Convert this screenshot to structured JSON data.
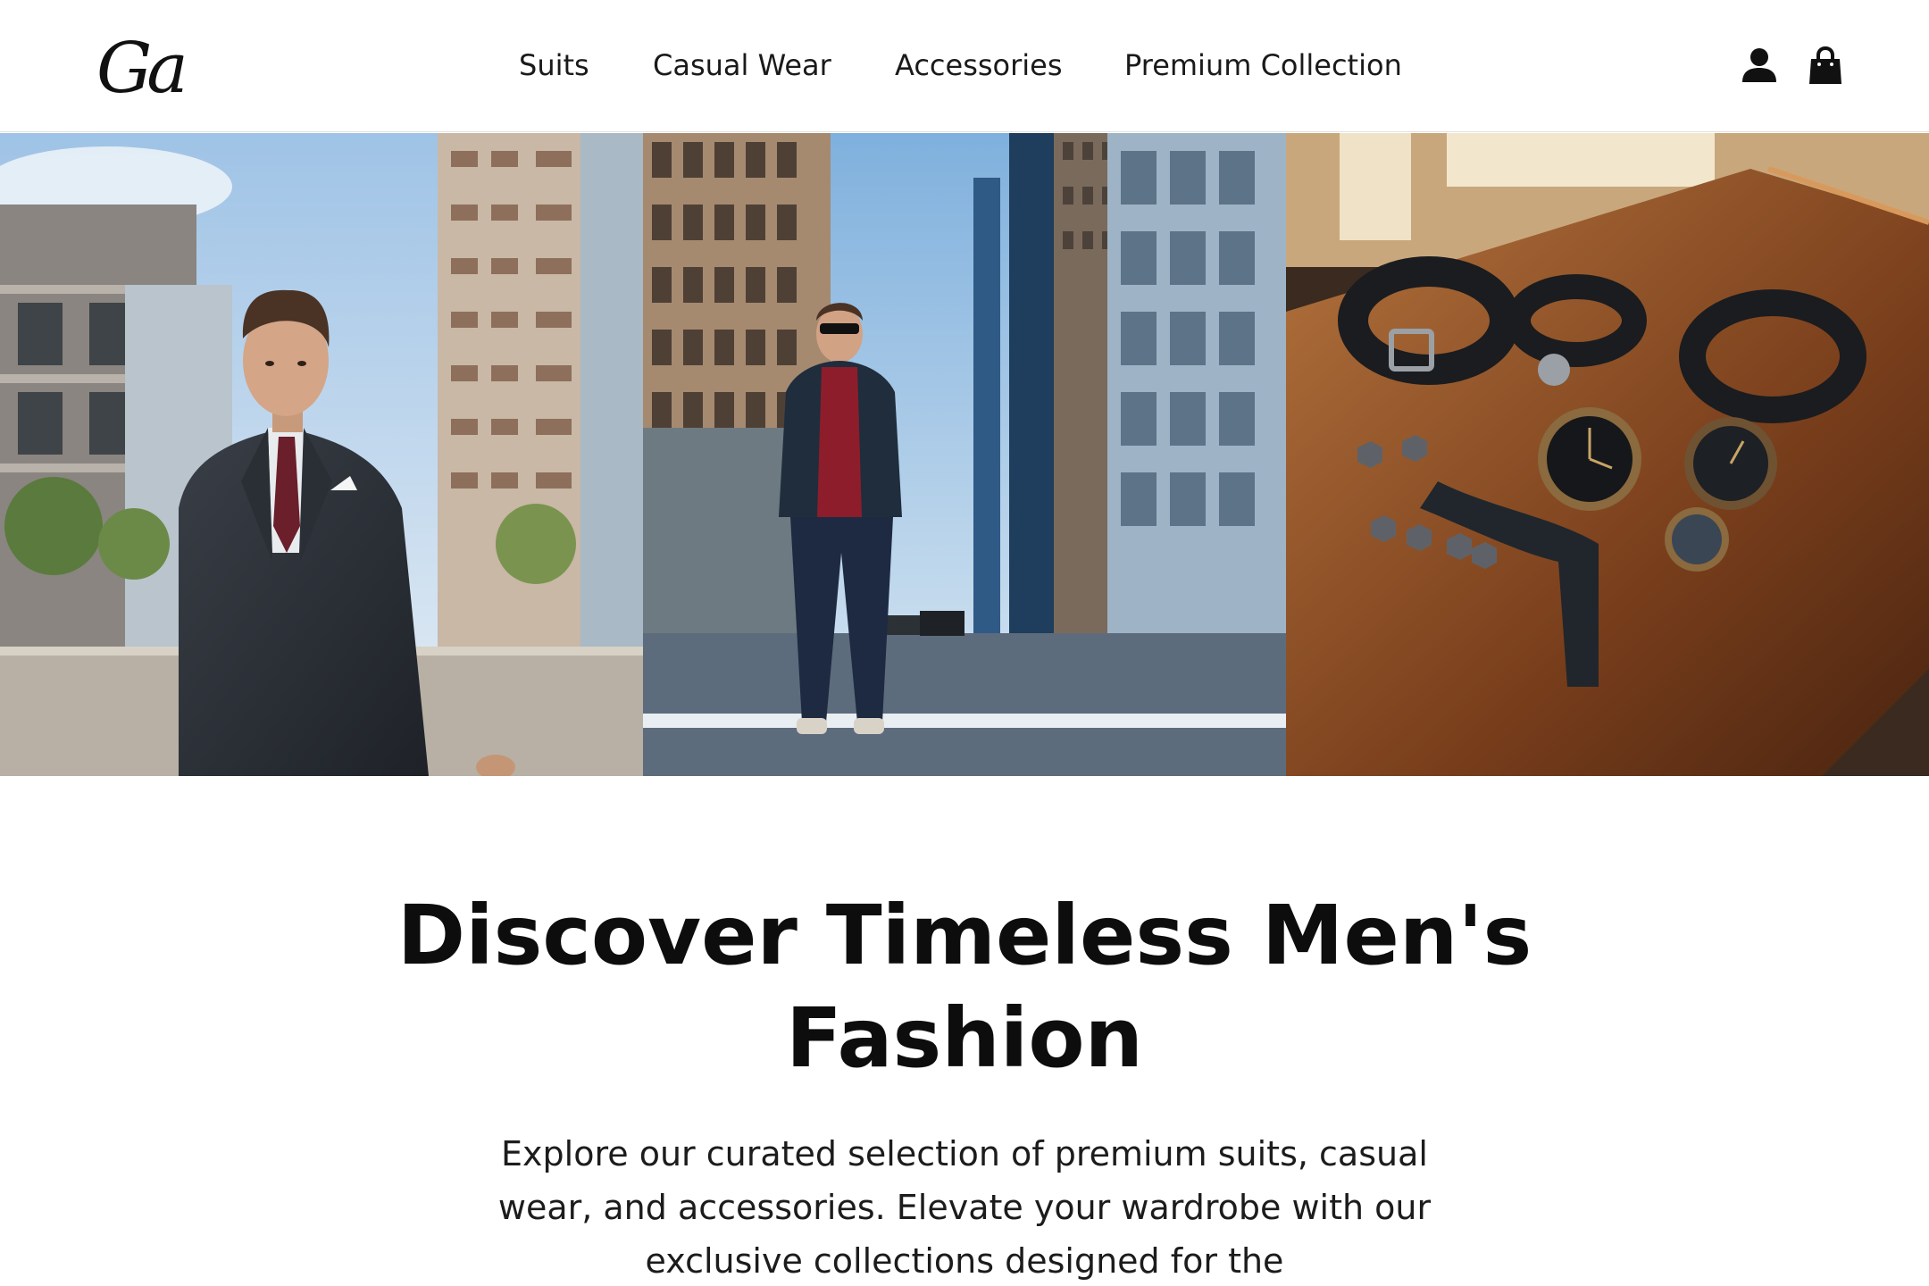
{
  "header": {
    "logo_text": "Ga",
    "nav": [
      {
        "label": "Suits"
      },
      {
        "label": "Casual Wear"
      },
      {
        "label": "Accessories"
      },
      {
        "label": "Premium Collection"
      }
    ],
    "icons": {
      "account": "user-icon",
      "cart": "shopping-bag-icon"
    }
  },
  "hero": {
    "images": [
      {
        "subject": "suit-model-photo"
      },
      {
        "subject": "casual-wear-model-photo"
      },
      {
        "subject": "accessories-photo"
      }
    ]
  },
  "main": {
    "headline": "Discover Timeless Men's Fashion",
    "description": "Explore our curated selection of premium suits, casual wear, and accessories. Elevate your wardrobe with our exclusive collections designed for the"
  },
  "colors": {
    "background": "#ffffff",
    "text": "#111111",
    "border": "#e2e2e2"
  }
}
